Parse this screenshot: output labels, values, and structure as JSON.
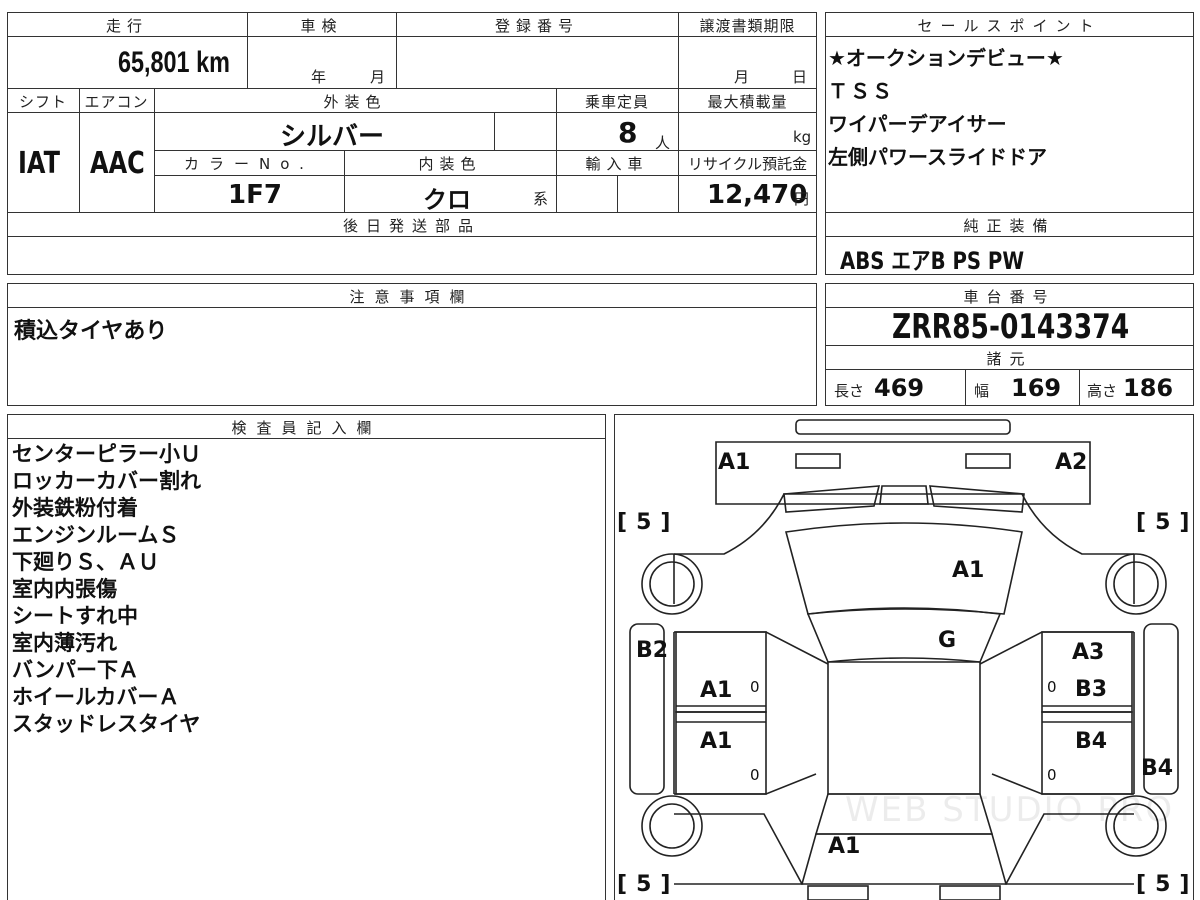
{
  "labels": {
    "mileage": "走行",
    "inspection": "車検",
    "registration_no": "登録番号",
    "transfer_deadline": "譲渡書類期限",
    "sales_point": "セールスポイント",
    "shift": "シフト",
    "aircon": "エアコン",
    "exterior_color": "外装色",
    "capacity": "乗車定員",
    "max_load": "最大積載量",
    "color_no": "カラーNo.",
    "interior_color": "内装色",
    "import": "輸入車",
    "recycle_fee": "リサイクル預託金",
    "later_parts": "後日発送部品",
    "standard_equipment": "純正装備",
    "cautions": "注意事項欄",
    "chassis_no": "車台番号",
    "specs": "諸元",
    "inspector": "検査員記入欄",
    "year_unit": "年",
    "month_unit": "月",
    "day_unit": "日",
    "person_unit": "人",
    "kg_unit": "kg",
    "yen_unit": "円",
    "kei_unit": "系",
    "length": "長さ",
    "width": "幅",
    "height": "高さ"
  },
  "values": {
    "mileage": "65,801 km",
    "shift": "IAT",
    "aircon": "AAC",
    "exterior_color": "シルバー",
    "capacity": "8",
    "color_no": "1F7",
    "interior_color": "クロ",
    "recycle_fee": "12,470",
    "chassis_no": "ZRR85-0143374",
    "length": "469",
    "width": "169",
    "height": "186",
    "standard_equipment": "ABS エアB PS PW",
    "cautions": "積込タイヤあり"
  },
  "sales_points": [
    "★オークションデビュー★",
    "ＴＳＳ",
    "ワイパーデアイサー",
    "左側パワースライドドア"
  ],
  "inspector_notes": [
    "センターピラー小Ｕ",
    "ロッカーカバー割れ",
    "外装鉄粉付着",
    "エンジンルームＳ",
    "下廻りＳ、ＡＵ",
    "室内内張傷",
    "シートすれ中",
    "室内薄汚れ",
    "バンパー下Ａ",
    "ホイールカバーＡ",
    "スタッドレスタイヤ"
  ],
  "damage_map": {
    "front_left": "A1",
    "front_right": "A2",
    "hood": "A1",
    "roof_glass": "G",
    "left_pillar": "B2",
    "left_front_door": "A1",
    "left_rear_door": "A1",
    "right_front_door_1": "A3",
    "right_front_door_2": "B3",
    "right_rear_door": "B4",
    "right_rear_pillar": "B4",
    "rear": "A1",
    "tire_front_left": "5",
    "tire_front_right": "5",
    "tire_rear_left": "5",
    "tire_rear_right": "5",
    "door_zero_1": "0",
    "door_zero_2": "0",
    "door_zero_3": "0",
    "door_zero_4": "0"
  },
  "watermark": "WEB STUDIO PRO"
}
